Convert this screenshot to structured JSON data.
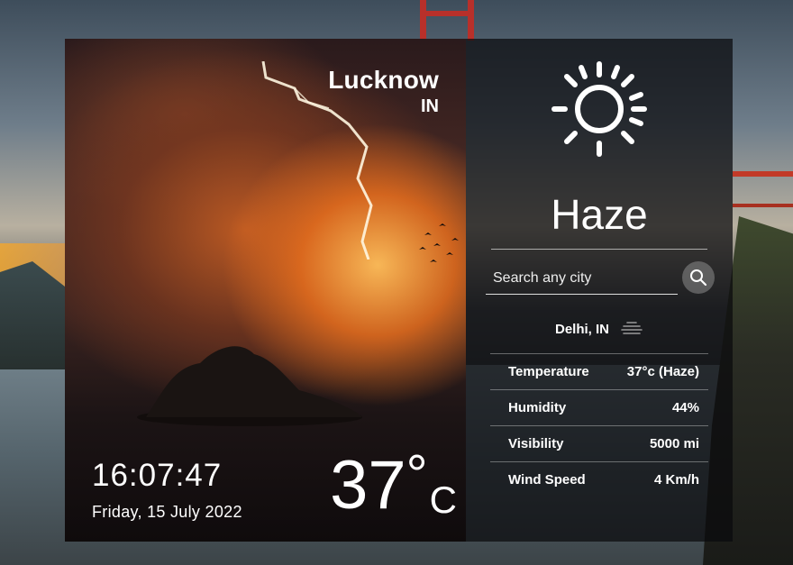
{
  "location": {
    "city": "Lucknow",
    "country": "IN"
  },
  "time": {
    "clock": "16:07:47",
    "date": "Friday, 15 July 2022"
  },
  "current": {
    "temperature": "37",
    "degree": "°",
    "unit": "C",
    "condition": "Haze"
  },
  "search": {
    "placeholder": "Search any city"
  },
  "result": {
    "place": "Delhi, IN"
  },
  "stats": [
    {
      "label": "Temperature",
      "value": "37°c (Haze)"
    },
    {
      "label": "Humidity",
      "value": "44%"
    },
    {
      "label": "Visibility",
      "value": "5000 mi"
    },
    {
      "label": "Wind Speed",
      "value": "4 Km/h"
    }
  ],
  "icons": {
    "weather": "sun-icon",
    "search": "search-icon",
    "haze": "haze-icon"
  }
}
